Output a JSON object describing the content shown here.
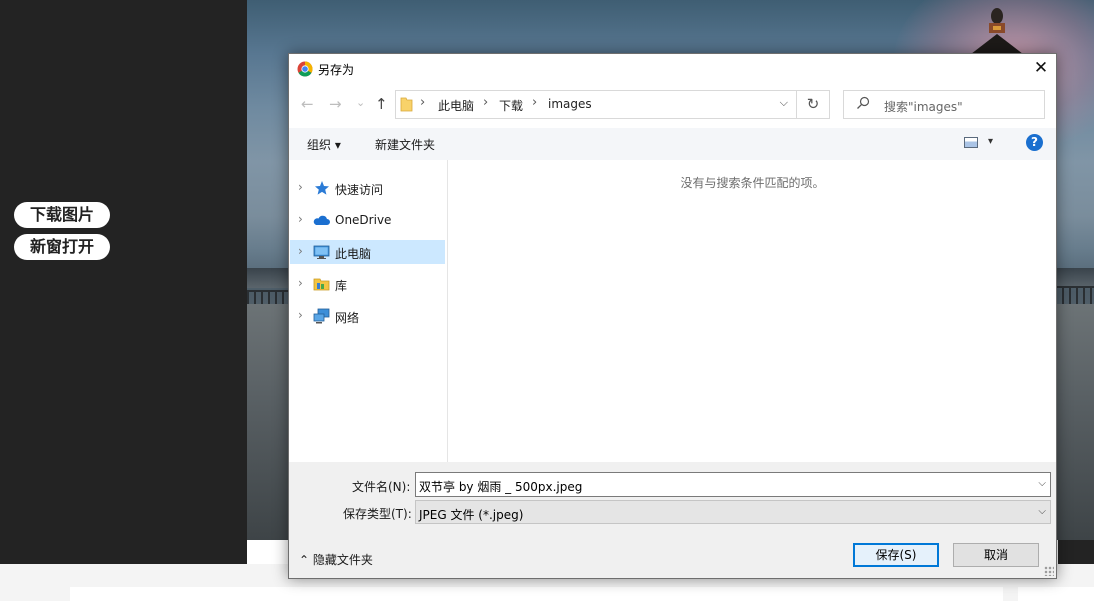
{
  "page": {
    "side_buttons": [
      "下载图片",
      "新窗打开"
    ]
  },
  "dialog": {
    "title": "另存为",
    "close_glyph": "✕",
    "nav": {
      "back": "←",
      "forward": "→",
      "recent": "⌄",
      "up": "↑"
    },
    "address": {
      "crumbs": [
        "此电脑",
        "下载",
        "images"
      ],
      "separator": "›",
      "dropdown": "⌵",
      "refresh": "↻"
    },
    "search": {
      "placeholder": "搜索\"images\""
    },
    "toolbar": {
      "organize": "组织 ▾",
      "new_folder": "新建文件夹",
      "view_dd": "▾",
      "help": "?"
    },
    "nav_items": [
      {
        "label": "快速访问",
        "icon": "quick-access-star-icon",
        "selected": false
      },
      {
        "label": "OneDrive",
        "icon": "onedrive-cloud-icon",
        "selected": false
      },
      {
        "label": "此电脑",
        "icon": "this-pc-monitor-icon",
        "selected": true
      },
      {
        "label": "库",
        "icon": "library-icon",
        "selected": false
      },
      {
        "label": "网络",
        "icon": "network-icon",
        "selected": false
      }
    ],
    "chevron": "›",
    "empty_message": "没有与搜索条件匹配的项。",
    "filename_label": "文件名(N):",
    "filename_value": "双节亭 by 烟雨 _ 500px.jpeg",
    "filetype_label": "保存类型(T):",
    "filetype_value": "JPEG 文件 (*.jpeg)",
    "dropdown_glyph": "⌵",
    "hide_folders": "⌃ 隐藏文件夹",
    "save_button": "保存(S)",
    "cancel_button": "取消"
  },
  "colors": {
    "accent": "#0078d7",
    "selection": "#cce8ff",
    "help": "#1a6fcf"
  }
}
